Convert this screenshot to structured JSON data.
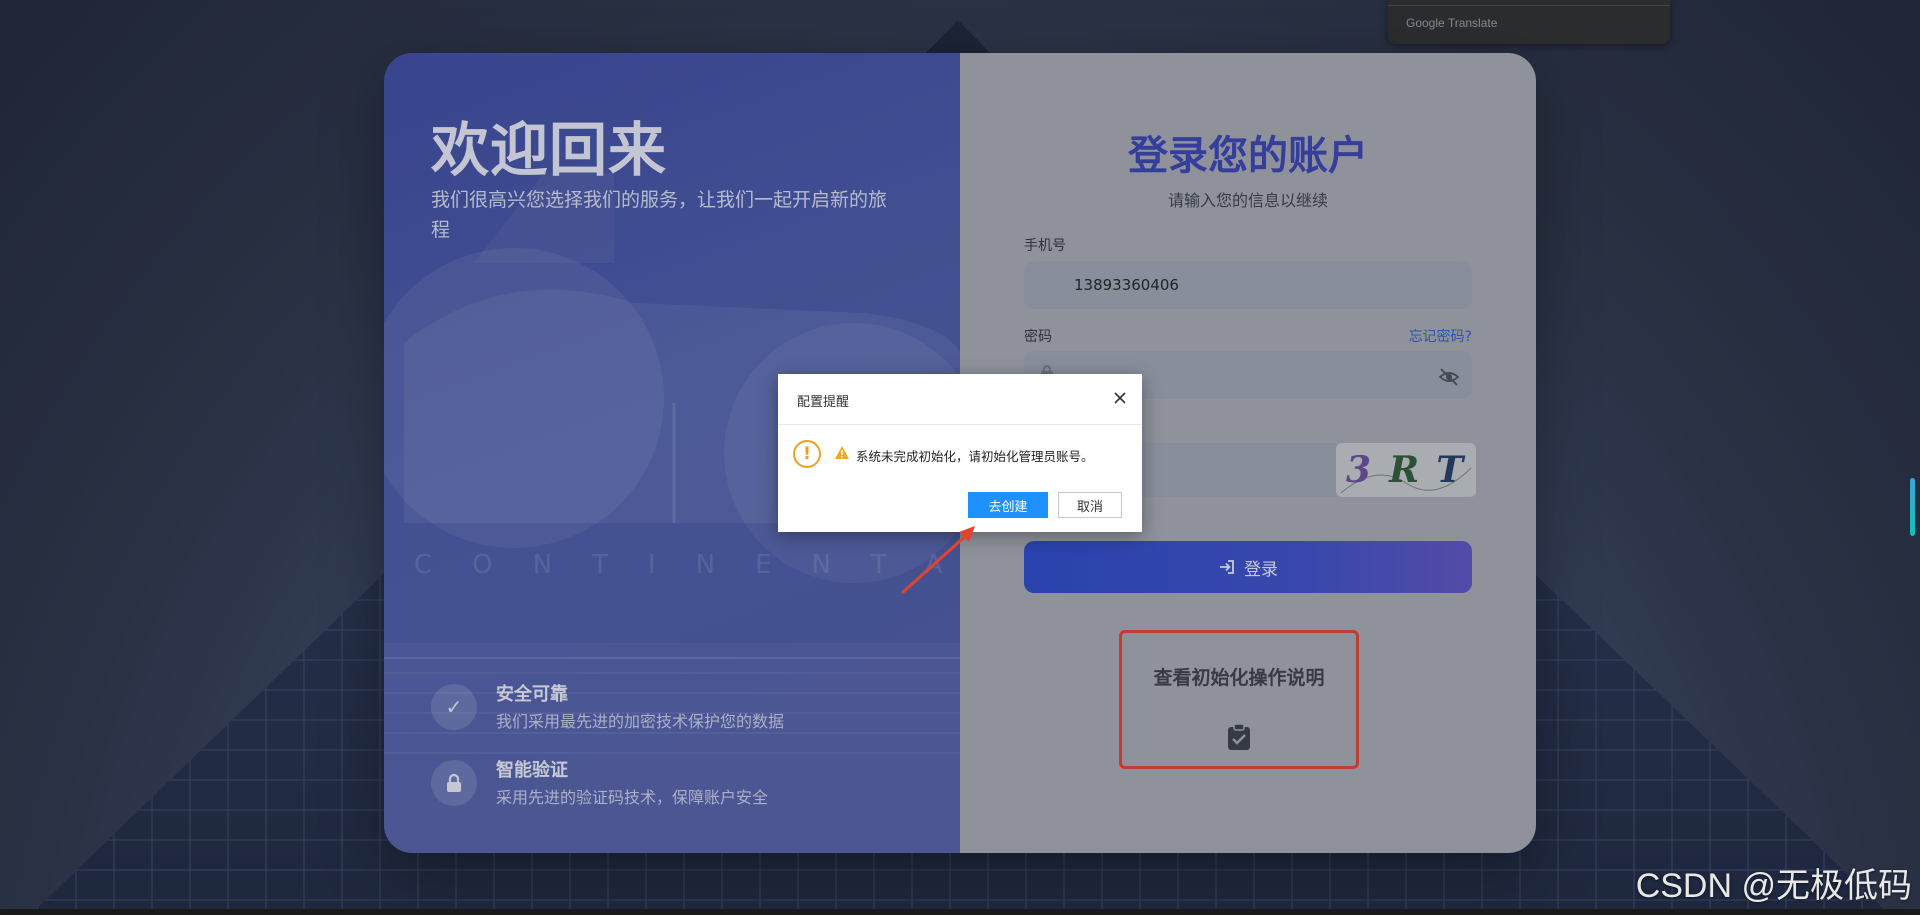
{
  "google_translate": {
    "label": "Google Translate"
  },
  "left": {
    "title": "欢迎回来",
    "subtitle": "我们很高兴您选择我们的服务，让我们一起开启新的旅程",
    "features": [
      {
        "icon": "check-icon",
        "title": "安全可靠",
        "desc": "我们采用最先进的加密技术保护您的数据"
      },
      {
        "icon": "lock-icon",
        "title": "智能验证",
        "desc": "采用先进的验证码技术，保障账户安全"
      }
    ]
  },
  "login": {
    "title": "登录您的账户",
    "subtitle": "请输入您的信息以继续",
    "phone_label": "手机号",
    "phone_value": "13893360406",
    "password_label": "密码",
    "forgot_link": "忘记密码?",
    "captcha_text": "3RT",
    "login_button": "登录",
    "init_guide": "查看初始化操作说明"
  },
  "dialog": {
    "title": "配置提醒",
    "message": "系统未完成初始化，请初始化管理员账号。",
    "confirm": "去创建",
    "cancel": "取消"
  },
  "watermark": "CSDN @无极低码",
  "colors": {
    "accent": "#3a43b3",
    "dialog_primary": "#1e90ff",
    "highlight": "#e0442e"
  }
}
